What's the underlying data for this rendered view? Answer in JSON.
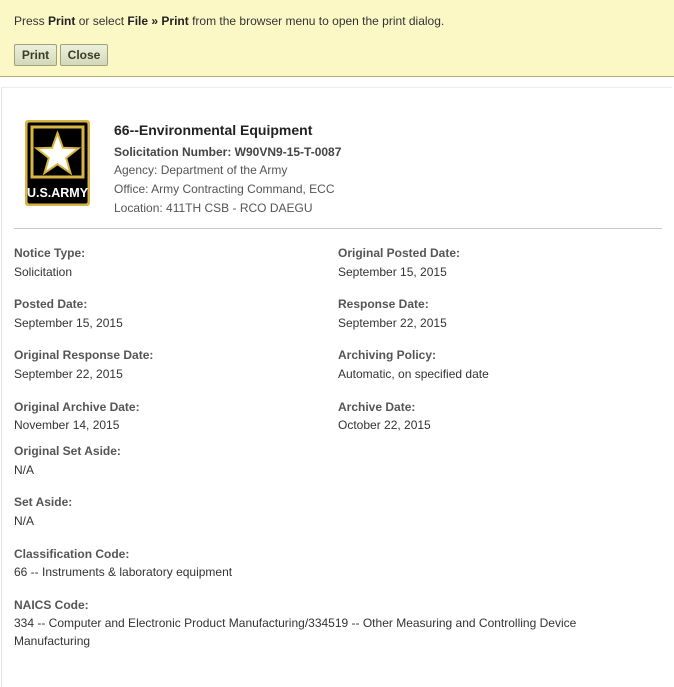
{
  "print_bar": {
    "msg_press": "Press ",
    "msg_print_word": "Print",
    "msg_or": " or select ",
    "msg_file_word": "File",
    "msg_arrow": " » ",
    "msg_print_word2": "Print",
    "msg_rest": " from the browser menu to open the print dialog.",
    "print_label": "Print",
    "close_label": "Close"
  },
  "header": {
    "logo_text": "U.S.ARMY",
    "title": "66--Environmental Equipment",
    "solicitation": "Solicitation Number: W90VN9-15-T-0087",
    "agency": "Agency: Department of the Army",
    "office": "Office: Army Contracting Command, ECC",
    "location": "Location: 411TH CSB - RCO DAEGU"
  },
  "colors": {
    "banner_bg": "#fcf8c6",
    "logo_bg": "#000000",
    "logo_gold": "#d8b445"
  },
  "fields": {
    "notice_type": {
      "label": "Notice Type:",
      "value": "Solicitation"
    },
    "original_posted_date": {
      "label": "Original Posted Date:",
      "value": "September 15, 2015"
    },
    "posted_date": {
      "label": "Posted Date:",
      "value": "September 15, 2015"
    },
    "response_date": {
      "label": "Response Date:",
      "value": "September 22, 2015"
    },
    "original_response_date": {
      "label": "Original Response Date:",
      "value": "September 22, 2015"
    },
    "archiving_policy": {
      "label": "Archiving Policy:",
      "value": "Automatic, on specified date"
    },
    "original_archive_date": {
      "label": "Original Archive Date:",
      "value": "November 14, 2015"
    },
    "archive_date": {
      "label": "Archive Date:",
      "value": "October 22, 2015"
    },
    "original_set_aside": {
      "label": "Original Set Aside:",
      "value": "N/A"
    },
    "set_aside": {
      "label": "Set Aside:",
      "value": "N/A"
    },
    "classification_code": {
      "label": "Classification Code:",
      "value": "66 -- Instruments & laboratory equipment"
    },
    "naics_code": {
      "label": "NAICS Code:",
      "value": "334 -- Computer and Electronic Product Manufacturing/334519 -- Other Measuring and Controlling Device Manufacturing"
    }
  }
}
